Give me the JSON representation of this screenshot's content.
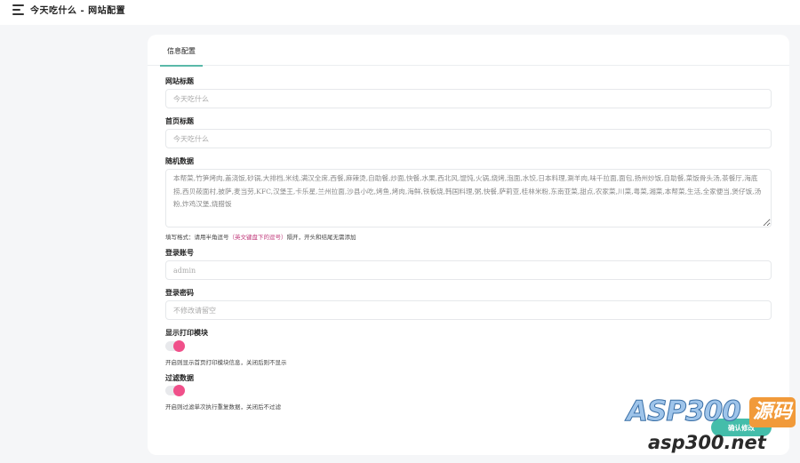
{
  "header": {
    "title": "今天吃什么 - 网站配置",
    "menu_icon": "menu-icon"
  },
  "tabs": [
    {
      "label": "信息配置",
      "active": true
    }
  ],
  "form": {
    "site_title": {
      "label": "网站标题",
      "placeholder": "今天吃什么",
      "value": ""
    },
    "home_title": {
      "label": "首页标题",
      "placeholder": "今天吃什么",
      "value": ""
    },
    "random_data": {
      "label": "随机数据",
      "value": "本帮菜,竹笋烤肉,盖浇饭,砂锅,大排档,米线,满汉全席,西餐,麻辣烫,自助餐,炒面,快餐,水果,西北风,馄饨,火锅,烧烤,泡面,水饺,日本料理,涮羊肉,味千拉面,面包,扬州炒饭,自助餐,菜饭骨头汤,茶餐厅,海底捞,西贝莜面村,披萨,麦当劳,KFC,汉堡王,卡乐星,兰州拉面,沙县小吃,烤鱼,烤肉,海鲜,铁板烧,韩国料理,粥,快餐,萨莉亚,桂林米粉,东南亚菜,甜点,农家菜,川菜,粤菜,湘菜,本帮菜,生活,全家便当,煲仔饭,汤粉,炸鸡汉堡,烧腊饭",
      "help_prefix": "填写格式：请用半角逗号",
      "help_highlight": "（英文键盘下的逗号）",
      "help_suffix": "隔开，开头和结尾无需添加"
    },
    "login_account": {
      "label": "登录账号",
      "placeholder": "admin",
      "value": ""
    },
    "login_password": {
      "label": "登录密码",
      "placeholder": "不修改请留空",
      "value": ""
    },
    "show_print": {
      "label": "显示打印模块",
      "enabled": true,
      "help": "开启则显示首页打印模块信息，关闭后则不显示"
    },
    "filter_data": {
      "label": "过滤数据",
      "enabled": true,
      "help": "开启则过滤单次执行重复数据，关闭后不过滤"
    },
    "submit_label": "确认修改"
  },
  "watermark": {
    "logo": "ASP300",
    "badge": "源码",
    "domain": "asp300.net"
  },
  "colors": {
    "accent": "#44bdaa",
    "switch_on": "#f0508a",
    "highlight": "#c0387a"
  }
}
